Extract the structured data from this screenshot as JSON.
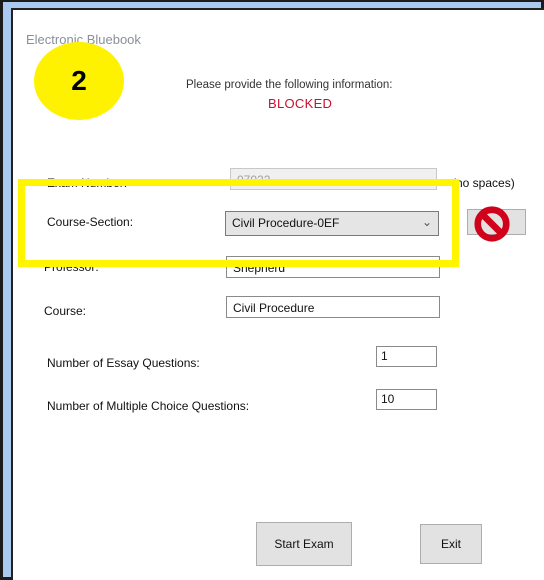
{
  "window": {
    "title": "Electronic Bluebook"
  },
  "header": {
    "instruction": "Please provide the following information:",
    "status": "BLOCKED"
  },
  "form": {
    "exam_number": {
      "label": "Exam Number:",
      "value": "07022",
      "hint": "(no spaces)"
    },
    "course_section": {
      "label": "Course-Section:",
      "value": "Civil Procedure-0EF"
    },
    "professor": {
      "label": "Professor:",
      "value": "Shepherd"
    },
    "course": {
      "label": "Course:",
      "value": "Civil Procedure"
    },
    "essay_questions": {
      "label": "Number of Essay Questions:",
      "value": "1"
    },
    "mc_questions": {
      "label": "Number of Multiple Choice Questions:",
      "value": "10"
    }
  },
  "buttons": {
    "start": "Start Exam",
    "exit": "Exit"
  },
  "annotations": {
    "step_number": "2",
    "highlight_color": "#fff500",
    "blocked_icon": "prohibited-icon",
    "blocked_icon_color": "#d0021b"
  }
}
